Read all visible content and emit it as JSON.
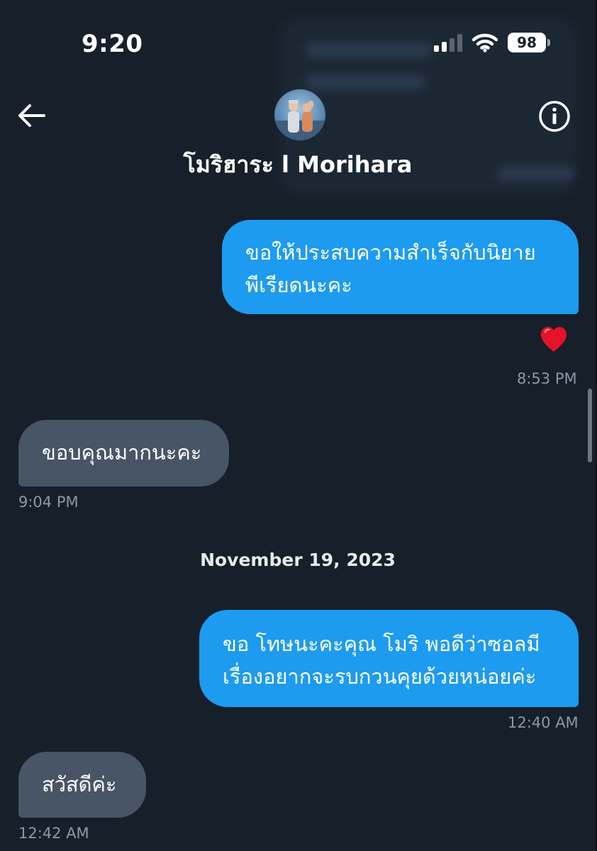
{
  "status_bar": {
    "time": "9:20",
    "battery": "98"
  },
  "header": {
    "contact_name": "โมริฮาระ l Morihara",
    "back_icon": "arrow-left-icon",
    "info_icon": "info-circle-icon"
  },
  "messages": [
    {
      "direction": "sent",
      "lines": [
        "ขอให้ประสบความสำเร็จกับนิยาย",
        "พีเรียดนะคะ"
      ],
      "reaction": "❤️",
      "time": "8:53 PM"
    },
    {
      "direction": "received",
      "lines": [
        "ขอบคุณมากนะคะ"
      ],
      "time": "9:04 PM"
    },
    {
      "direction": "sent",
      "lines": [
        "ขอ โทษนะคะคุณ โมริ พอดีว่าซอลมี",
        "เรื่องอยากจะรบกวนคุยด้วยหน่อยค่ะ"
      ],
      "time": "12:40 AM"
    },
    {
      "direction": "received",
      "lines": [
        "สวัสดีค่ะ"
      ],
      "time": "12:42 AM"
    }
  ],
  "date_separator": "November 19, 2023",
  "colors": {
    "background": "#17202a",
    "sent_bubble": "#1d9bf0",
    "received_bubble": "#475566",
    "timestamp": "#8b98a5"
  }
}
